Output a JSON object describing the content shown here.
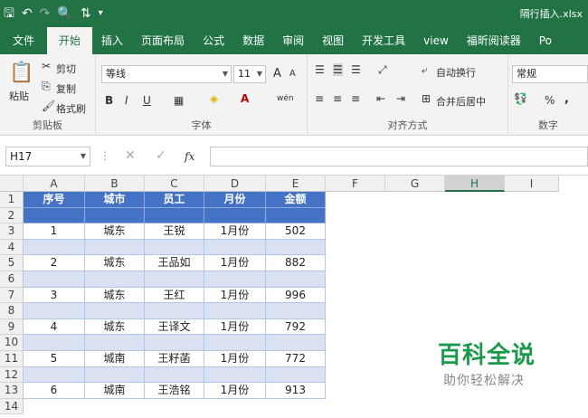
{
  "window": {
    "title": "隔行插入.xlsx"
  },
  "tabs": [
    "文件",
    "开始",
    "插入",
    "页面布局",
    "公式",
    "数据",
    "审阅",
    "视图",
    "开发工具",
    "view",
    "福昕阅读器",
    "Po"
  ],
  "ribbon": {
    "clipboard": {
      "paste": "粘贴",
      "cut": "剪切",
      "copy": "复制",
      "format_painter": "格式刷",
      "label": "剪贴板"
    },
    "font": {
      "name": "等线",
      "size": "11",
      "bold": "B",
      "italic": "I",
      "underline": "U",
      "label": "字体",
      "grow": "A",
      "shrink": "A",
      "wen": "wén"
    },
    "align": {
      "wrap": "自动换行",
      "merge": "合并后居中",
      "label": "对齐方式"
    },
    "number": {
      "format": "常规",
      "percent": "%",
      "comma": ",",
      "label": "数字"
    }
  },
  "formula_bar": {
    "name_box": "H17",
    "fx": "fx",
    "value": ""
  },
  "columns": [
    "A",
    "B",
    "C",
    "D",
    "E",
    "F",
    "G",
    "H",
    "I"
  ],
  "selected_column": "H",
  "rows": [
    "1",
    "2",
    "3",
    "4",
    "5",
    "6",
    "7",
    "8",
    "9",
    "10",
    "11",
    "12",
    "13",
    "14"
  ],
  "table": {
    "headers": [
      "序号",
      "城市",
      "员工",
      "月份",
      "金额"
    ],
    "records": [
      [
        "1",
        "城东",
        "王锐",
        "1月份",
        "502"
      ],
      [
        "2",
        "城东",
        "王品如",
        "1月份",
        "882"
      ],
      [
        "3",
        "城东",
        "王红",
        "1月份",
        "996"
      ],
      [
        "4",
        "城东",
        "王译文",
        "1月份",
        "792"
      ],
      [
        "5",
        "城南",
        "王籽菡",
        "1月份",
        "772"
      ],
      [
        "6",
        "城南",
        "王浩铭",
        "1月份",
        "913"
      ]
    ]
  },
  "watermark": {
    "title": "百科全说",
    "subtitle": "助你轻松解决"
  }
}
